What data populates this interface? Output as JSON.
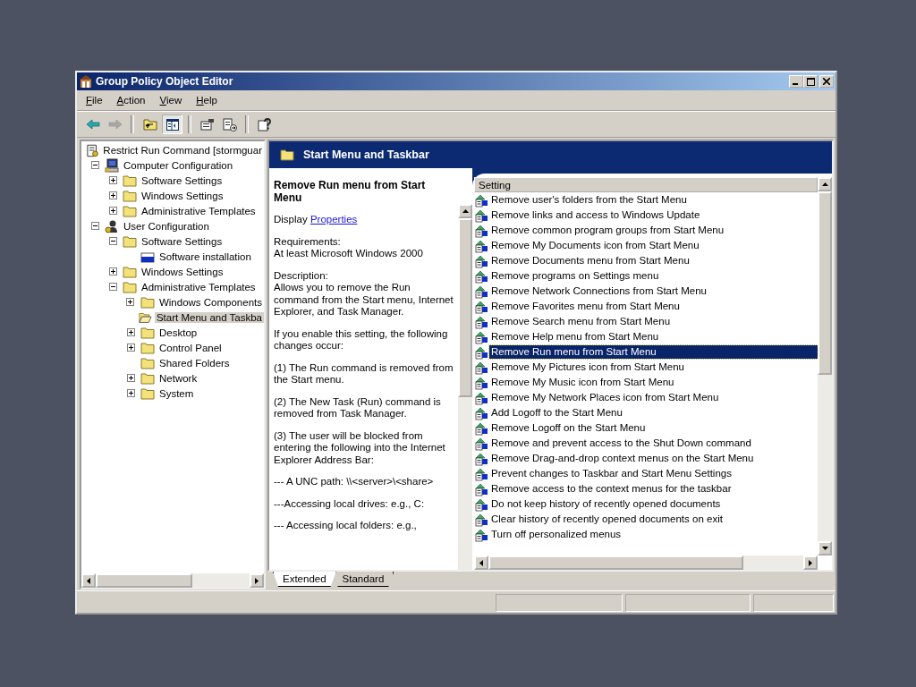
{
  "window": {
    "title": "Group Policy Object Editor"
  },
  "menu": [
    "File",
    "Action",
    "View",
    "Help"
  ],
  "toolbar": [
    [
      {
        "kind": "back",
        "disabled": false,
        "pressed": false
      },
      {
        "kind": "forward",
        "disabled": true,
        "pressed": false
      }
    ],
    [
      {
        "kind": "up",
        "disabled": false,
        "pressed": false
      },
      {
        "kind": "tree",
        "disabled": false,
        "pressed": true
      }
    ],
    [
      {
        "kind": "properties",
        "disabled": false,
        "pressed": false
      },
      {
        "kind": "export",
        "disabled": false,
        "pressed": false
      }
    ],
    [
      {
        "kind": "help",
        "disabled": false,
        "pressed": false
      }
    ]
  ],
  "tree": [
    {
      "label": "Restrict Run Command [stormguar",
      "kind": "policy",
      "selected": false,
      "children": [
        {
          "label": "Computer Configuration",
          "kind": "computer",
          "expanded": true,
          "selected": false,
          "children": [
            {
              "label": "Software Settings",
              "kind": "folder",
              "expanded": false,
              "selected": false
            },
            {
              "label": "Windows Settings",
              "kind": "folder",
              "expanded": false,
              "selected": false
            },
            {
              "label": "Administrative Templates",
              "kind": "folder",
              "expanded": false,
              "selected": false
            }
          ]
        },
        {
          "label": "User Configuration",
          "kind": "user",
          "expanded": true,
          "selected": false,
          "children": [
            {
              "label": "Software Settings",
              "kind": "folder",
              "expanded": true,
              "selected": false,
              "children": [
                {
                  "label": "Software installation",
                  "kind": "install",
                  "selected": false
                }
              ]
            },
            {
              "label": "Windows Settings",
              "kind": "folder",
              "expanded": false,
              "selected": false
            },
            {
              "label": "Administrative Templates",
              "kind": "folder",
              "expanded": true,
              "selected": false,
              "children": [
                {
                  "label": "Windows Components",
                  "kind": "folder",
                  "expanded": false,
                  "selected": false
                },
                {
                  "label": "Start Menu and Taskba",
                  "kind": "folder",
                  "selected": true
                },
                {
                  "label": "Desktop",
                  "kind": "folder",
                  "expanded": false,
                  "selected": false
                },
                {
                  "label": "Control Panel",
                  "kind": "folder",
                  "expanded": false,
                  "selected": false
                },
                {
                  "label": "Shared Folders",
                  "kind": "folder",
                  "selected": false
                },
                {
                  "label": "Network",
                  "kind": "folder",
                  "expanded": false,
                  "selected": false
                },
                {
                  "label": "System",
                  "kind": "folder",
                  "expanded": false,
                  "selected": false
                }
              ]
            }
          ]
        }
      ]
    }
  ],
  "header": {
    "title": "Start Menu and Taskbar"
  },
  "description": {
    "title": "Remove Run menu from Start Menu",
    "display": "Display",
    "link": "Properties",
    "paragraphs": [
      "Requirements:\nAt least Microsoft Windows 2000",
      "Description:\nAllows you to remove the Run command from the Start menu, Internet Explorer, and Task Manager.",
      "If you enable this setting, the following changes occur:",
      "(1) The Run command is removed from the Start menu.",
      "(2) The New Task (Run) command is removed from Task Manager.",
      "(3) The user will be blocked from entering the following into the Internet Explorer Address Bar:",
      "--- A UNC path: \\\\<server>\\<share>",
      "---Accessing local drives:  e.g., C:",
      "--- Accessing local folders: e.g.,"
    ]
  },
  "settings": {
    "column": "Setting",
    "rows": [
      {
        "label": "Remove user's folders from the Start Menu",
        "selected": false
      },
      {
        "label": "Remove links and access to Windows Update",
        "selected": false
      },
      {
        "label": "Remove common program groups from Start Menu",
        "selected": false
      },
      {
        "label": "Remove My Documents icon from Start Menu",
        "selected": false
      },
      {
        "label": "Remove Documents menu from Start Menu",
        "selected": false
      },
      {
        "label": "Remove programs on Settings menu",
        "selected": false
      },
      {
        "label": "Remove Network Connections from Start Menu",
        "selected": false
      },
      {
        "label": "Remove Favorites menu from Start Menu",
        "selected": false
      },
      {
        "label": "Remove Search menu from Start Menu",
        "selected": false
      },
      {
        "label": "Remove Help menu from Start Menu",
        "selected": false
      },
      {
        "label": "Remove Run menu from Start Menu",
        "selected": true
      },
      {
        "label": "Remove My Pictures icon from Start Menu",
        "selected": false
      },
      {
        "label": "Remove My Music icon from Start Menu",
        "selected": false
      },
      {
        "label": "Remove My Network Places icon from Start Menu",
        "selected": false
      },
      {
        "label": "Add Logoff to the Start Menu",
        "selected": false
      },
      {
        "label": "Remove Logoff on the Start Menu",
        "selected": false
      },
      {
        "label": "Remove and prevent access to the Shut Down command",
        "selected": false
      },
      {
        "label": "Remove Drag-and-drop context menus on the Start Menu",
        "selected": false
      },
      {
        "label": "Prevent changes to Taskbar and Start Menu Settings",
        "selected": false
      },
      {
        "label": "Remove access to the context menus for the taskbar",
        "selected": false
      },
      {
        "label": "Do not keep history of recently opened documents",
        "selected": false
      },
      {
        "label": "Clear history of recently opened documents on exit",
        "selected": false
      },
      {
        "label": "Turn off personalized menus",
        "selected": false
      }
    ]
  },
  "tabs": [
    {
      "label": "Extended",
      "selected": true
    },
    {
      "label": "Standard",
      "selected": false
    }
  ]
}
